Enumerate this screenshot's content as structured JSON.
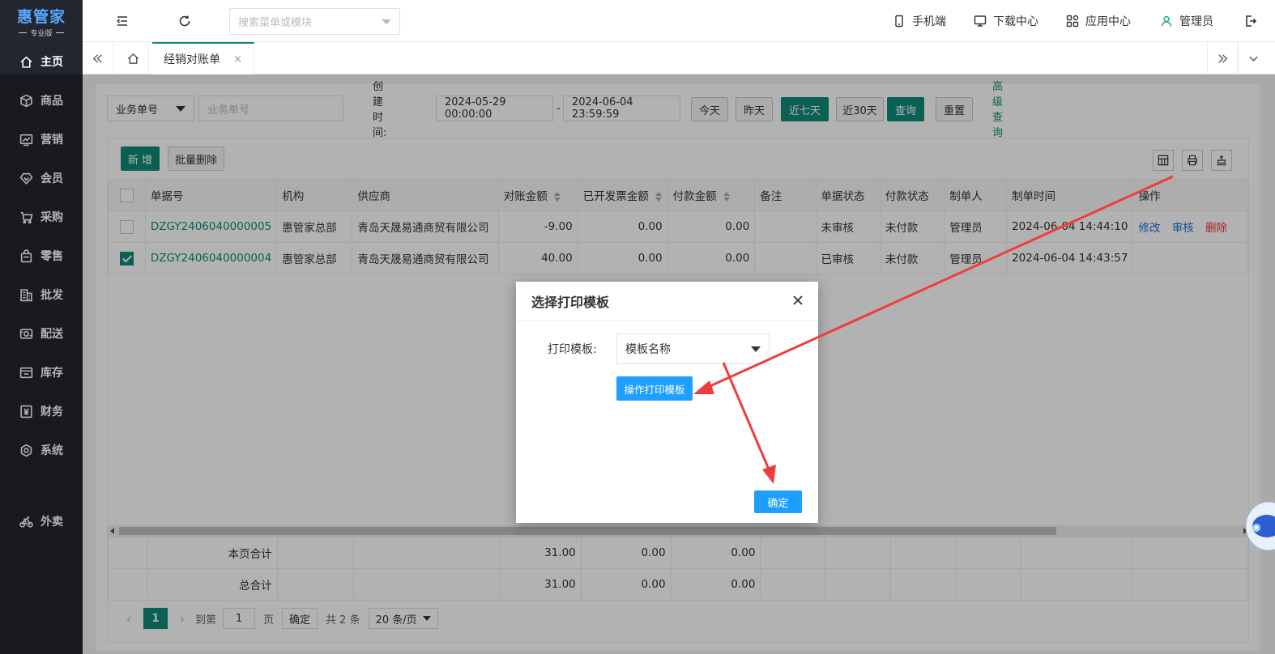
{
  "app": {
    "logo_main": "惠管家",
    "logo_sub": "专业版"
  },
  "sidebar": {
    "items": [
      {
        "label": "主页",
        "icon": "home-icon"
      },
      {
        "label": "商品",
        "icon": "box-icon"
      },
      {
        "label": "营销",
        "icon": "trend-chart-icon"
      },
      {
        "label": "会员",
        "icon": "diamond-icon"
      },
      {
        "label": "采购",
        "icon": "cart-icon"
      },
      {
        "label": "零售",
        "icon": "shopping-bag-icon"
      },
      {
        "label": "批发",
        "icon": "building-icon"
      },
      {
        "label": "配送",
        "icon": "delivery-icon"
      },
      {
        "label": "库存",
        "icon": "inventory-icon"
      },
      {
        "label": "财务",
        "icon": "yen-icon"
      },
      {
        "label": "系统",
        "icon": "settings-icon"
      },
      {
        "label": "外卖",
        "icon": "bike-icon"
      }
    ]
  },
  "header": {
    "search_placeholder": "搜索菜单或模块",
    "mobile": "手机端",
    "download": "下载中心",
    "apps": "应用中心",
    "user": "管理员"
  },
  "tabs": {
    "active": "经销对账单",
    "close": "×"
  },
  "filter": {
    "type_select": "业务单号",
    "number_placeholder": "业务单号",
    "created_label": "创建时间:",
    "start": "2024-05-29 00:00:00",
    "dash": "-",
    "end": "2024-06-04 23:59:59",
    "today": "今天",
    "yesterday": "昨天",
    "last7": "近七天",
    "last30": "近30天",
    "query": "查询",
    "reset": "重置",
    "advanced": "高级查询"
  },
  "toolbar": {
    "add": "新 增",
    "batch_delete": "批量删除"
  },
  "table": {
    "headers": [
      "单据号",
      "机构",
      "供应商",
      "对账金额",
      "已开发票金额",
      "付款金额",
      "备注",
      "单据状态",
      "付款状态",
      "制单人",
      "制单时间",
      "操作"
    ],
    "rows": [
      {
        "checked": false,
        "no": "DZGY2406040000005",
        "org": "惠管家总部",
        "supplier": "青岛天晟易通商贸有限公司",
        "amount": "-9.00",
        "invoiced": "0.00",
        "paid": "0.00",
        "note": "",
        "status": "未审核",
        "pay_status": "未付款",
        "creator": "管理员",
        "time": "2024-06-04 14:44:10",
        "actions": [
          "修改",
          "审核",
          "删除"
        ]
      },
      {
        "checked": true,
        "no": "DZGY2406040000004",
        "org": "惠管家总部",
        "supplier": "青岛天晟易通商贸有限公司",
        "amount": "40.00",
        "invoiced": "0.00",
        "paid": "0.00",
        "note": "",
        "status": "已审核",
        "pay_status": "未付款",
        "creator": "管理员",
        "time": "2024-06-04 14:43:57",
        "actions": []
      }
    ]
  },
  "summary": {
    "page_label": "本页合计",
    "page": {
      "amount": "31.00",
      "invoiced": "0.00",
      "paid": "0.00"
    },
    "total_label": "总合计",
    "total": {
      "amount": "31.00",
      "invoiced": "0.00",
      "paid": "0.00"
    }
  },
  "pager": {
    "current": "1",
    "goto": "到第",
    "page_input": "1",
    "page_unit": "页",
    "confirm": "确定",
    "total": "共 2 条",
    "page_size": "20 条/页"
  },
  "dialog": {
    "title": "选择打印模板",
    "label": "打印模板:",
    "select_value": "模板名称",
    "template_button": "操作打印模板",
    "ok": "确定"
  },
  "colors": {
    "primary": "#0e8a77",
    "blue": "#1e9fff",
    "sidebar": "#23262e",
    "arrow": "#ee3d3d"
  }
}
